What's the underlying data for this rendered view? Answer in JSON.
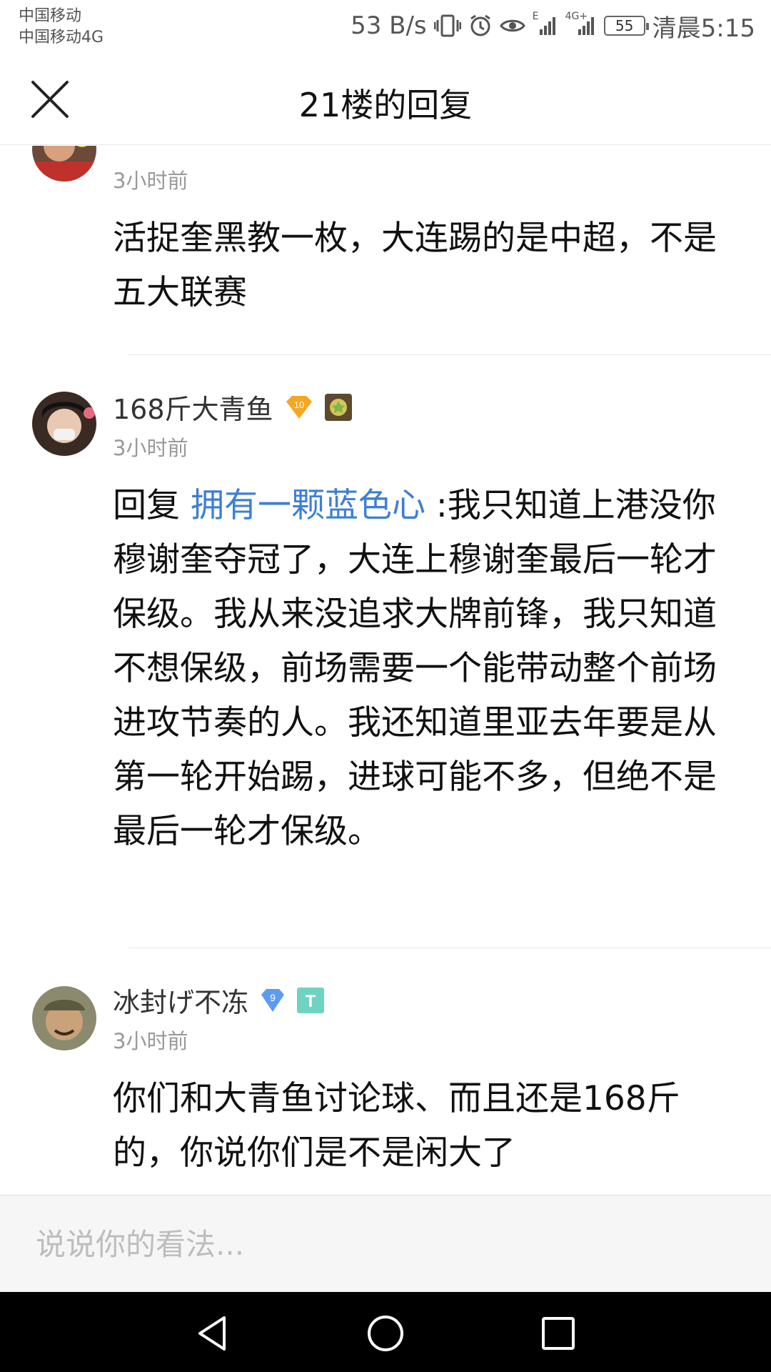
{
  "status_bar": {
    "carrier1": "中国移动",
    "carrier2": "中国移动4G",
    "net_speed": "53 B/s",
    "signal1_label": "E",
    "signal2_label": "4G+",
    "battery": "55",
    "time": "清晨5:15"
  },
  "header": {
    "title": "21楼的回复"
  },
  "comments": [
    {
      "username": "",
      "time": "3小时前",
      "body": "活捉奎黑教一枚，大连踢的是中超，不是五大联赛"
    },
    {
      "username": "168斤大青鱼",
      "level": "10",
      "time": "3小时前",
      "reply_prefix": "回复 ",
      "reply_to": "拥有一颗蓝色心",
      "body": " :我只知道上港没你穆谢奎夺冠了，大连上穆谢奎最后一轮才保级。我从来没追求大牌前锋，我只知道不想保级，前场需要一个能带动整个前场进攻节奏的人。我还知道里亚去年要是从第一轮开始踢，进球可能不多，但绝不是最后一轮才保级。"
    },
    {
      "username": "冰封げ不冻",
      "level": "9",
      "tag": "T",
      "time": "3小时前",
      "body": "你们和大青鱼讨论球、而且还是168斤的，你说你们是不是闲大了"
    }
  ],
  "input": {
    "placeholder": "说说你的看法..."
  },
  "colors": {
    "link": "#3e7fd3",
    "level_badge_orange": "#f5a623",
    "level_badge_blue": "#5b9cf0",
    "tag_green": "#6fd3c2"
  }
}
